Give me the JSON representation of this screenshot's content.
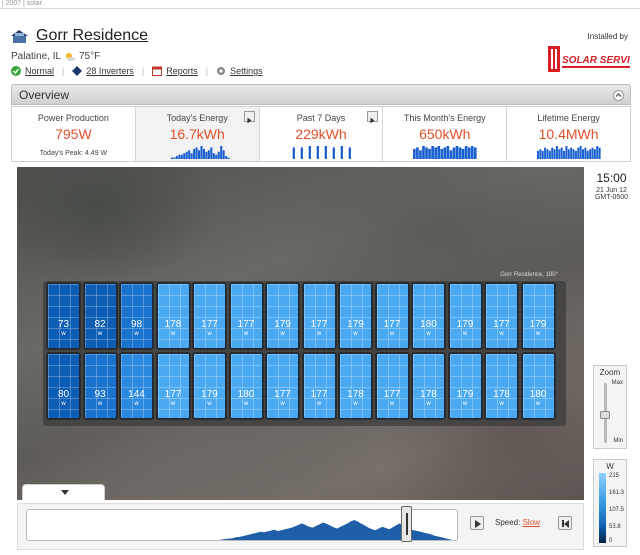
{
  "topstrip": {
    "text": "j 2007 | solar"
  },
  "site": {
    "title": "Gorr Residence",
    "location": "Palatine, IL",
    "temperature": "75°F",
    "weather_icon": "partly-sunny-icon",
    "links": [
      {
        "icon": "check-icon",
        "label": "Normal",
        "color": "#3aa33a"
      },
      {
        "icon": "inverter-icon",
        "label": "28 Inverters",
        "color": "#1e3a6e"
      },
      {
        "icon": "calendar-icon",
        "label": "Reports",
        "color": "#c0392b"
      },
      {
        "icon": "gear-icon",
        "label": "Settings",
        "color": "#777777"
      }
    ],
    "installed_by": "Installed by",
    "installer_logo": "SOLAR SERVICE"
  },
  "overview": {
    "title": "Overview"
  },
  "tiles": [
    {
      "label": "Power Production",
      "value": "795W",
      "peak": "Today's Peak: 4.49 W",
      "selected": false,
      "has_play": false
    },
    {
      "label": "Today's Energy",
      "value": "16.7kWh",
      "selected": true,
      "has_play": true,
      "spark": [
        0,
        0,
        1,
        1,
        2,
        3,
        3,
        4,
        5,
        6,
        4,
        7,
        8,
        6,
        9,
        7,
        5,
        6,
        8,
        4,
        3,
        5,
        9,
        6,
        2,
        1
      ]
    },
    {
      "label": "Past 7 Days",
      "value": "229kWh",
      "selected": false,
      "has_play": true,
      "spark": [
        0,
        8,
        0,
        0,
        8,
        0,
        0,
        9,
        0,
        0,
        9,
        0,
        0,
        9,
        0,
        0,
        8,
        0,
        0,
        9,
        0,
        0,
        8,
        0
      ]
    },
    {
      "label": "This Month's Energy",
      "value": "650kWh",
      "selected": false,
      "has_play": false,
      "spark": [
        7,
        8,
        6,
        9,
        8,
        7,
        9,
        8,
        9,
        7,
        8,
        9,
        6,
        8,
        9,
        8,
        7,
        9,
        8,
        9,
        8
      ]
    },
    {
      "label": "Lifetime Energy",
      "value": "10.4MWh",
      "selected": false,
      "has_play": false,
      "spark": [
        5,
        6,
        5,
        7,
        6,
        5,
        7,
        6,
        8,
        6,
        7,
        5,
        8,
        6,
        7,
        6,
        5,
        7,
        8,
        6,
        7,
        5,
        6,
        7,
        6,
        8,
        7
      ]
    }
  ],
  "map": {
    "house_label": "Gorr Residence, 180°",
    "unit": "w",
    "rows": [
      [
        73,
        82,
        98,
        178,
        177,
        177,
        179,
        177,
        179,
        177,
        180,
        179,
        177,
        179
      ],
      [
        80,
        93,
        144,
        177,
        179,
        180,
        177,
        177,
        178,
        177,
        178,
        179,
        178,
        180
      ]
    ]
  },
  "clock": {
    "time": "15:00",
    "date": "21 Jun 12",
    "tz": "GMT-0500"
  },
  "zoom": {
    "title": "Zoom",
    "max": "Max",
    "min": "Min",
    "level": 0.5
  },
  "legend": {
    "title": "W",
    "ticks": [
      "215",
      "161.3",
      "107.5",
      "53.8",
      "0"
    ]
  },
  "timeline": {
    "speed_label": "Speed:",
    "speed_value": "Slow",
    "position": 0.88,
    "profile": [
      0,
      0,
      0,
      0,
      0,
      0,
      0,
      0,
      0,
      0,
      0,
      0,
      0,
      0,
      0,
      0,
      0,
      0,
      0,
      0,
      0,
      0,
      0,
      0,
      0,
      0,
      0,
      0,
      0,
      0,
      0,
      0,
      0,
      0,
      0,
      0,
      0,
      0,
      0,
      0,
      0,
      0,
      0,
      0,
      0,
      0,
      0,
      0,
      0,
      0,
      0,
      0,
      1,
      2,
      3,
      4,
      6,
      7,
      8,
      9,
      11,
      12,
      14,
      16,
      18,
      20,
      22,
      24,
      23,
      25,
      27,
      29,
      26,
      28,
      30,
      32,
      34,
      37,
      41,
      44,
      40,
      36,
      34,
      38,
      42,
      46,
      43,
      39,
      35,
      32,
      36,
      40,
      44,
      49,
      52,
      48,
      43,
      39,
      34,
      30,
      28,
      32,
      36,
      33,
      30,
      35,
      40,
      44,
      38,
      32,
      30,
      28,
      26,
      24,
      22,
      20,
      18,
      15,
      13,
      11,
      9,
      7,
      5,
      3,
      2
    ]
  }
}
